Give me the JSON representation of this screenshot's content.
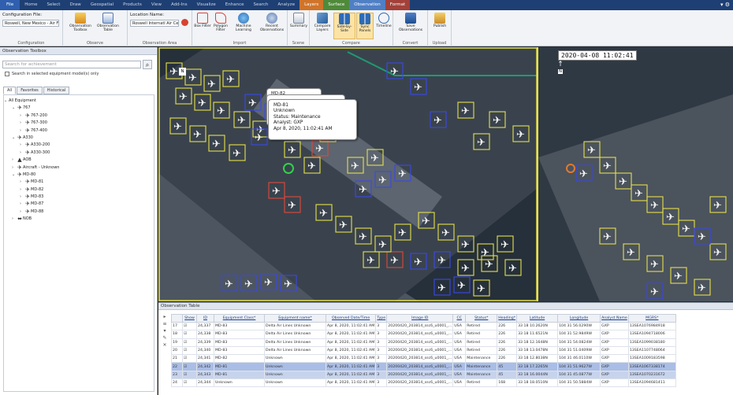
{
  "menu": {
    "items": [
      "File",
      "Home",
      "Select",
      "Draw",
      "Geospatial",
      "Products",
      "View",
      "Add-Ins",
      "Visualize",
      "Enhance",
      "Search",
      "Analyze",
      "Layers",
      "Surface",
      "Observation",
      "Format"
    ]
  },
  "ribbon": {
    "config_file_label": "Configuration File:",
    "config_file_value": "Roswell, New Mexico - Air F",
    "config_group": "Configuration",
    "obs_toolbox": "Observation Toolbox",
    "obs_table": "Observation Table",
    "observe_group": "Observe",
    "location_label": "Location Name:",
    "location_value": "Roswell Internatl Air Cent",
    "obs_area_group": "Observation Area",
    "box_filter": "Box Filter",
    "polygon_filter": "Polygon Filter",
    "ml": "Machine Learning",
    "recent_obs": "Recent Observations",
    "import_group": "Import",
    "summary": "Summary",
    "compare_layers": "Compare Layers",
    "side_by_side": "Side-by-Side",
    "sync_panels": "Sync Panels",
    "timeline": "Timeline",
    "compare_group": "Compare",
    "save_obs": "Save Observations",
    "convert_group": "Convert",
    "publish": "Publish",
    "upload_group": "Upload",
    "scene_group": "Scene",
    "analyze_group": "Analyze"
  },
  "left_panel": {
    "title": "Observation Toolbox",
    "search_placeholder": "Search for achievement",
    "checkbox_label": "Search in selected equipment model(s) only",
    "tabs": [
      "All",
      "Favorites",
      "Historical"
    ],
    "tree": [
      {
        "level": 0,
        "exp": "⌄",
        "label": "All Equipment"
      },
      {
        "level": 1,
        "exp": "⌄",
        "label": "767",
        "icon": "✈"
      },
      {
        "level": 2,
        "exp": "›",
        "label": "767-200",
        "icon": "✈"
      },
      {
        "level": 2,
        "exp": "›",
        "label": "767-300",
        "icon": "✈"
      },
      {
        "level": 2,
        "exp": "›",
        "label": "767-400",
        "icon": "✈"
      },
      {
        "level": 1,
        "exp": "⌄",
        "label": "A330",
        "icon": "✈"
      },
      {
        "level": 2,
        "exp": "›",
        "label": "A330-200",
        "icon": "✈"
      },
      {
        "level": 2,
        "exp": "›",
        "label": "A330-300",
        "icon": "✈"
      },
      {
        "level": 1,
        "exp": "›",
        "label": "AOB",
        "icon": "▲"
      },
      {
        "level": 1,
        "exp": "›",
        "label": "Aircraft - Unknown",
        "icon": "✈"
      },
      {
        "level": 1,
        "exp": "⌄",
        "label": "MD-80",
        "icon": "✈"
      },
      {
        "level": 2,
        "exp": "›",
        "label": "MD-81",
        "icon": "✈"
      },
      {
        "level": 2,
        "exp": "›",
        "label": "MD-82",
        "icon": "✈"
      },
      {
        "level": 2,
        "exp": "›",
        "label": "MD-83",
        "icon": "✈"
      },
      {
        "level": 2,
        "exp": "›",
        "label": "MD-87",
        "icon": "✈"
      },
      {
        "level": 2,
        "exp": "›",
        "label": "MD-88",
        "icon": "✈"
      },
      {
        "level": 1,
        "exp": "›",
        "label": "NOB",
        "icon": "⬌"
      }
    ]
  },
  "viewer": {
    "timestamp": "2020-04-08 11:02:41",
    "north_label": "N",
    "callout_back_title": "MD-82",
    "callout_lines": [
      "MD-81",
      "Unknown",
      "Status: Maintenance",
      "Analyst: GXP",
      "Apr 8, 2020, 11:02:41 AM"
    ]
  },
  "table": {
    "title": "Observation Table",
    "columns": [
      "",
      "Show",
      "ID",
      "Equipment Class*",
      "Equipment name*",
      "Observed Date/Time",
      "Type",
      "Image ID",
      "CC",
      "Status*",
      "Heading*",
      "Latitude",
      "Longitude",
      "Analyst Name",
      "MGRS*"
    ],
    "rows": [
      [
        "17",
        "☑",
        "24,337",
        "MD-83",
        "Delta Air Lines Unknown",
        "Apr 8, 2020, 11:02:41 AM",
        "3",
        "20200420_203814_ssc6_u0001_...",
        "USA",
        "Retired",
        "226",
        "33 18 10.2620N",
        "104 31 56.0290W",
        "GXP",
        "13SEA1076984918"
      ],
      [
        "18",
        "☑",
        "24,338",
        "MD-83",
        "Delta Air Lines Unknown",
        "Apr 8, 2020, 11:02:41 AM",
        "3",
        "20200420_203814_ssc6_u0001_...",
        "USA",
        "Retired",
        "226",
        "33 18 11.6521N",
        "104 31 52.9849W",
        "GXP",
        "13SEA1094718006"
      ],
      [
        "19",
        "☑",
        "24,339",
        "MD-83",
        "Delta Air Lines Unknown",
        "Apr 8, 2020, 11:02:41 AM",
        "3",
        "20200420_203814_ssc6_u0001_...",
        "USA",
        "Retired",
        "226",
        "33 18 12.1648N",
        "104 31 54.0824W",
        "GXP",
        "13SEA1099038180"
      ],
      [
        "20",
        "☑",
        "24,340",
        "MD-83",
        "Delta Air Lines Unknown",
        "Apr 8, 2020, 11:02:41 AM",
        "3",
        "20200420_203814_ssc6_u0001_...",
        "USA",
        "Retired",
        "226",
        "33 18 13.0478N",
        "104 31 51.0409W",
        "GXP",
        "13SEA1107748064"
      ],
      [
        "21",
        "☑",
        "24,341",
        "MD-82",
        "Unknown",
        "Apr 8, 2020, 11:02:41 AM",
        "3",
        "20200420_203814_ssc6_u0001_...",
        "USA",
        "Maintenance",
        "226",
        "33 18 12.8038N",
        "104 31 46.0110W",
        "GXP",
        "13SEA1009183598"
      ],
      [
        "22",
        "☑",
        "24,342",
        "MD-81",
        "Unknown",
        "Apr 8, 2020, 11:02:41 AM",
        "3",
        "20200420_203814_ssc6_u0001_...",
        "USA",
        "Maintenance",
        "45",
        "33 18 17.2265N",
        "104 31 51.9627W",
        "GXP",
        "13SEA1067338174"
      ],
      [
        "23",
        "☑",
        "24,343",
        "MD-81",
        "Unknown",
        "Apr 8, 2020, 11:02:41 AM",
        "3",
        "20200420_203814_ssc6_u0001_...",
        "USA",
        "Maintenance",
        "45",
        "33 18 16.0044N",
        "104 31 45.0877W",
        "GXP",
        "13SEA1070231672"
      ],
      [
        "24",
        "☑",
        "24,344",
        "Unknown",
        "Unknown",
        "Apr 8, 2020, 11:02:41 AM",
        "3",
        "20200420_203814_ssc6_u0001_...",
        "USA",
        "Retired",
        "168",
        "33 18 18.0510N",
        "104 31 50.5884W",
        "GXP",
        "13SEA1094681411"
      ]
    ]
  },
  "colors": {
    "menubar": "#1e3f73",
    "detect_yellow": "#e6e04a",
    "detect_blue": "#3a48e8",
    "detect_red": "#e0483a",
    "teal": "#1f9a72"
  }
}
